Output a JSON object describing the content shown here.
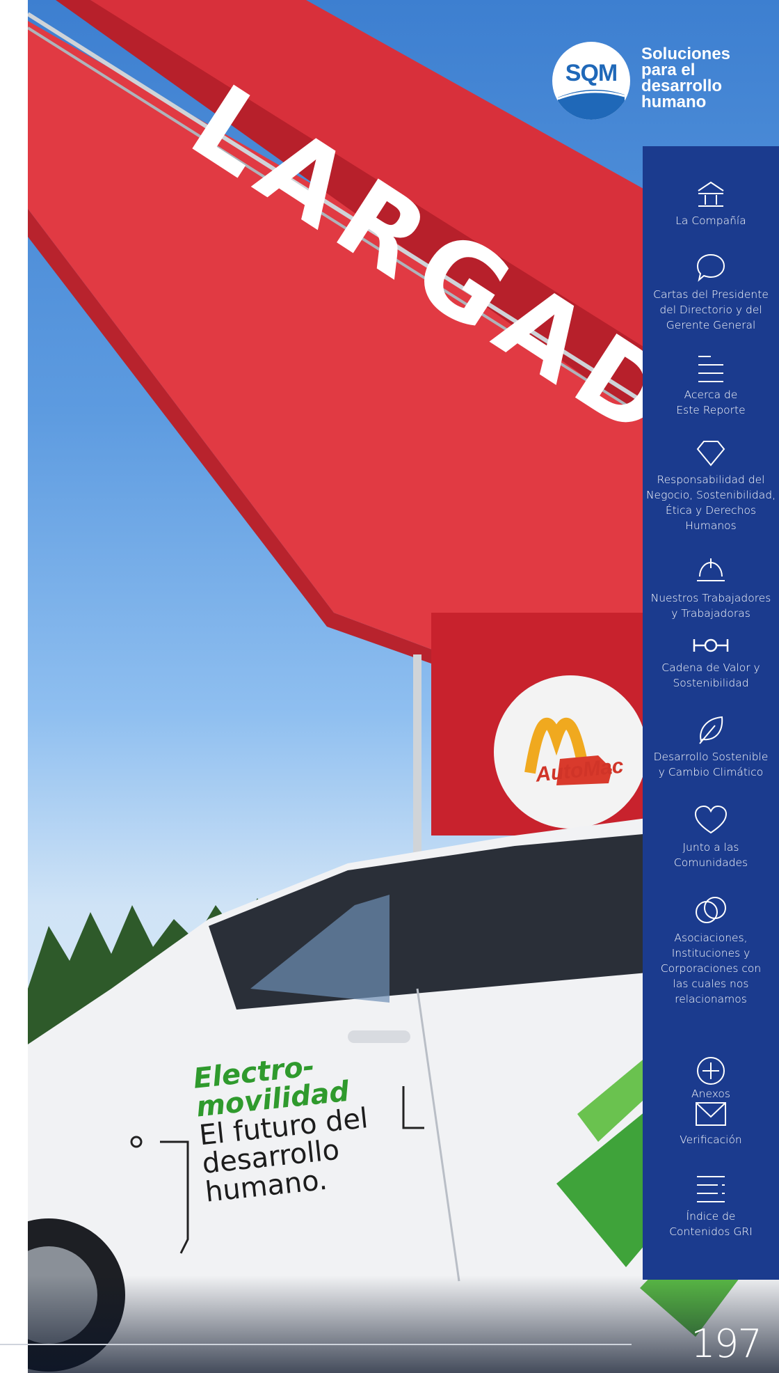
{
  "brand": {
    "logo_text": "SQM",
    "tagline": [
      "Soluciones",
      "para el",
      "desarrollo",
      "humano"
    ]
  },
  "photo": {
    "banner_text": "LARGADA",
    "tent_logo_text": "AutoMac",
    "car_side_text": [
      "Electro-",
      "movilidad",
      "El futuro del",
      "desarrollo",
      "humano."
    ]
  },
  "nav": {
    "items": [
      {
        "label": "La Compañía",
        "icon": "building-icon"
      },
      {
        "label": "Cartas del Presidente\ndel Directorio y del\nGerente General",
        "icon": "speech-bubble-icon"
      },
      {
        "label": "Acerca de\nEste Reporte",
        "icon": "list-lines-icon"
      },
      {
        "label": "Responsabilidad del\nNegocio, Sostenibilidad,\nÉtica y Derechos\nHumanos",
        "icon": "diamond-icon"
      },
      {
        "label": "Nuestros Trabajadores\ny Trabajadoras",
        "icon": "hard-hat-icon"
      },
      {
        "label": "Cadena de Valor y\nSostenibilidad",
        "icon": "chain-link-icon"
      },
      {
        "label": "Desarrollo Sostenible\ny Cambio Climático",
        "icon": "leaf-icon"
      },
      {
        "label": "Junto a las\nComunidades",
        "icon": "heart-icon"
      },
      {
        "label": "Asociaciones,\nInstituciones y\nCorporaciones con\nlas cuales nos\nrelacionamos",
        "icon": "overlapping-circles-icon"
      },
      {
        "label": "Anexos",
        "icon": "plus-circle-icon"
      },
      {
        "label": "Verificación",
        "icon": "envelope-icon"
      },
      {
        "label": "Índice de\nContenidos GRI",
        "icon": "index-lines-icon"
      }
    ]
  },
  "page": {
    "number": "197"
  },
  "colors": {
    "nav_bg": "#1b3b8e",
    "brand_blue": "#1f68b8",
    "banner_red": "#d42b3a"
  }
}
